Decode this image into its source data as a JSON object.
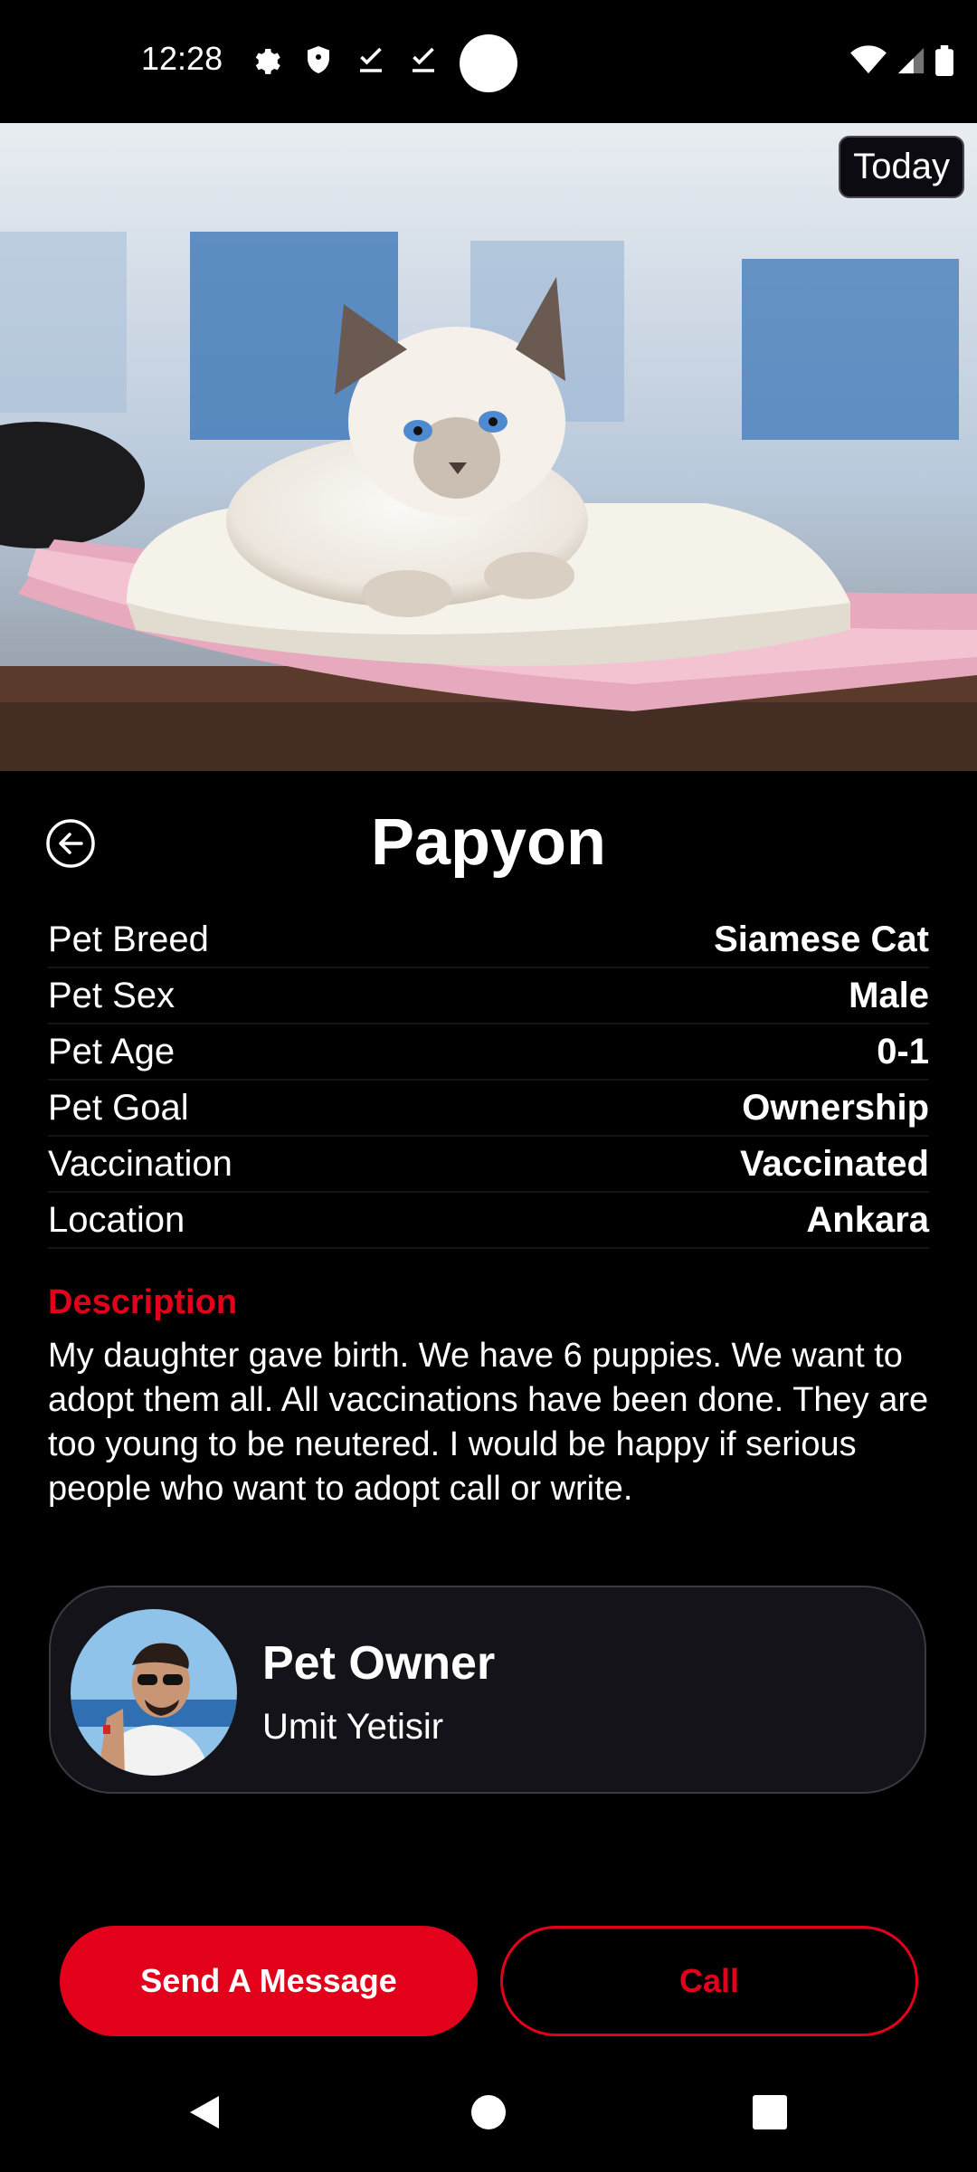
{
  "status_bar": {
    "time": "12:28",
    "left_icons": [
      "gear-icon",
      "shield-icon",
      "download-check-icon",
      "download-check-icon"
    ],
    "right_icons": [
      "wifi-icon",
      "signal-icon",
      "battery-icon"
    ]
  },
  "hero": {
    "badge": "Today"
  },
  "pet": {
    "name": "Papyon"
  },
  "details": [
    {
      "label": "Pet Breed",
      "value": "Siamese Cat"
    },
    {
      "label": "Pet Sex",
      "value": "Male"
    },
    {
      "label": "Pet Age",
      "value": "0-1"
    },
    {
      "label": "Pet Goal",
      "value": "Ownership"
    },
    {
      "label": "Vaccination",
      "value": "Vaccinated"
    },
    {
      "label": "Location",
      "value": "Ankara"
    }
  ],
  "description": {
    "title": "Description",
    "text": "My daughter gave birth. We have 6 puppies. We want to adopt them all. All vaccinations have been done. They are too young to be neutered. I would be happy if serious people who want to adopt call or write."
  },
  "owner": {
    "role": "Pet Owner",
    "name": "Umit Yetisir"
  },
  "actions": {
    "message_label": "Send A Message",
    "call_label": "Call"
  },
  "colors": {
    "accent": "#e3001b",
    "background": "#000000",
    "card": "#15131a"
  }
}
